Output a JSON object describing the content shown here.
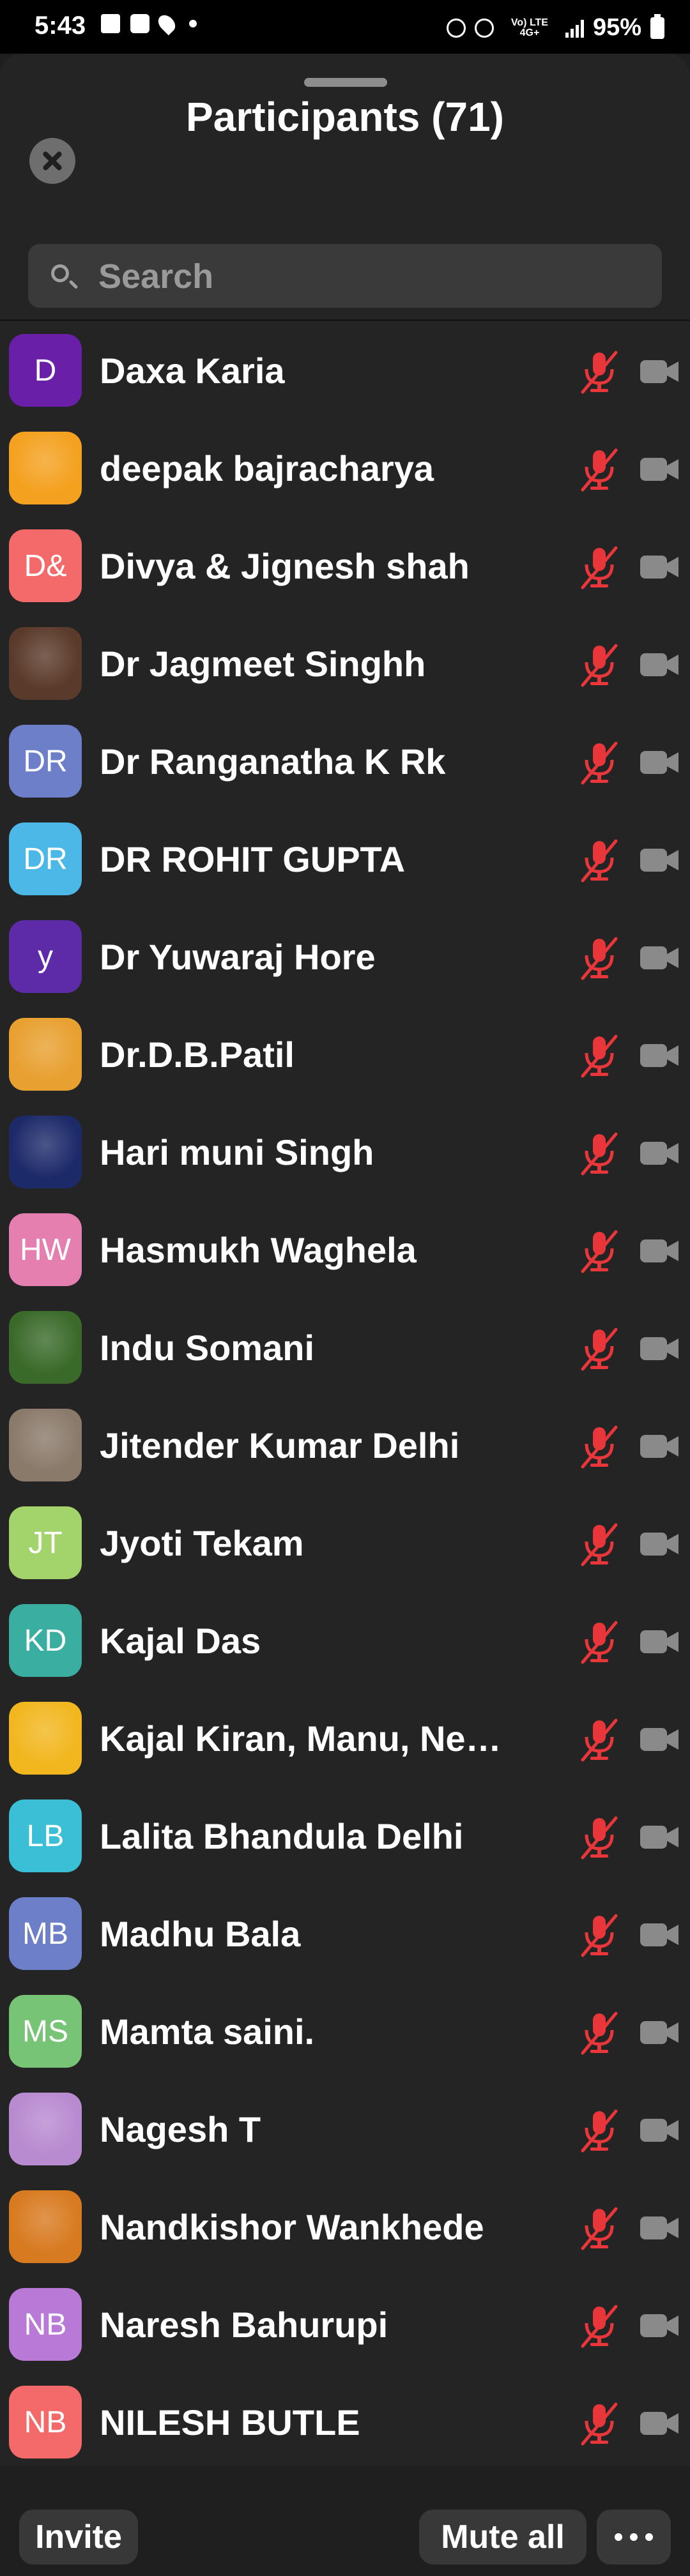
{
  "status": {
    "time": "5:43",
    "network": "Vo) LTE 4G+",
    "battery": "95%"
  },
  "header": {
    "title": "Participants (71)"
  },
  "search": {
    "placeholder": "Search"
  },
  "participants": [
    {
      "name": "Daxa Karia",
      "initials": "D",
      "color": "#6a1fa8"
    },
    {
      "name": "deepak bajracharya",
      "initials": "",
      "color": "#f4a11f"
    },
    {
      "name": "Divya & Jignesh shah",
      "initials": "D&",
      "color": "#f46a6a"
    },
    {
      "name": "Dr Jagmeet Singhh",
      "initials": "",
      "color": "#5a3a2a"
    },
    {
      "name": "Dr Ranganatha K Rk",
      "initials": "DR",
      "color": "#6c7fc8"
    },
    {
      "name": "DR ROHIT GUPTA",
      "initials": "DR",
      "color": "#4bb8e8"
    },
    {
      "name": "Dr Yuwaraj Hore",
      "initials": "y",
      "color": "#5d2aa8"
    },
    {
      "name": "Dr.D.B.Patil",
      "initials": "",
      "color": "#e8a030"
    },
    {
      "name": "Hari muni Singh",
      "initials": "",
      "color": "#1d2a6a"
    },
    {
      "name": "Hasmukh Waghela",
      "initials": "HW",
      "color": "#e47fb0"
    },
    {
      "name": "Indu Somani",
      "initials": "",
      "color": "#3a6a2a"
    },
    {
      "name": "Jitender Kumar Delhi",
      "initials": "",
      "color": "#8a7a6a"
    },
    {
      "name": "Jyoti Tekam",
      "initials": "JT",
      "color": "#a3d36b"
    },
    {
      "name": "Kajal Das",
      "initials": "KD",
      "color": "#3aaea0"
    },
    {
      "name": "Kajal Kiran, Manu, Neha…",
      "initials": "",
      "color": "#f2b71f"
    },
    {
      "name": "Lalita Bhandula Delhi",
      "initials": "LB",
      "color": "#3bbfd6"
    },
    {
      "name": "Madhu Bala",
      "initials": "MB",
      "color": "#6c7fc8"
    },
    {
      "name": "Mamta saini.",
      "initials": "MS",
      "color": "#77c476"
    },
    {
      "name": "Nagesh T",
      "initials": "",
      "color": "#b88ad0"
    },
    {
      "name": "Nandkishor Wankhede",
      "initials": "",
      "color": "#d87a20"
    },
    {
      "name": "Naresh Bahurupi",
      "initials": "NB",
      "color": "#b87ad6"
    },
    {
      "name": "NILESH BUTLE",
      "initials": "NB",
      "color": "#f46a6a"
    }
  ],
  "footer": {
    "invite": "Invite",
    "mute_all": "Mute all"
  },
  "colors": {
    "muted_mic": "#e8363a",
    "camera_off": "#8a8a8a"
  }
}
